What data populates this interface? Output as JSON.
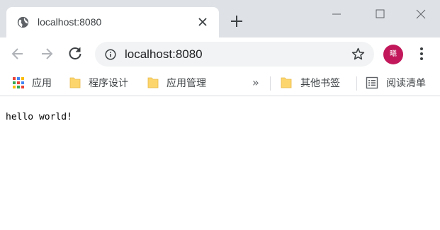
{
  "tab": {
    "title": "localhost:8080",
    "favicon": "globe-icon"
  },
  "toolbar": {
    "url": "localhost:8080",
    "avatar_initial": "曦",
    "avatar_color": "#c2185b"
  },
  "bookmarks": {
    "items": [
      {
        "label": "应用",
        "icon": "apps-grid-icon"
      },
      {
        "label": "程序设计",
        "icon": "folder-icon"
      },
      {
        "label": "应用管理",
        "icon": "folder-icon"
      }
    ],
    "overflow": "»",
    "other": {
      "label": "其他书签",
      "icon": "folder-icon"
    },
    "reading_list": {
      "label": "阅读清单",
      "icon": "reading-list-icon"
    }
  },
  "page": {
    "text": "hello world!"
  }
}
